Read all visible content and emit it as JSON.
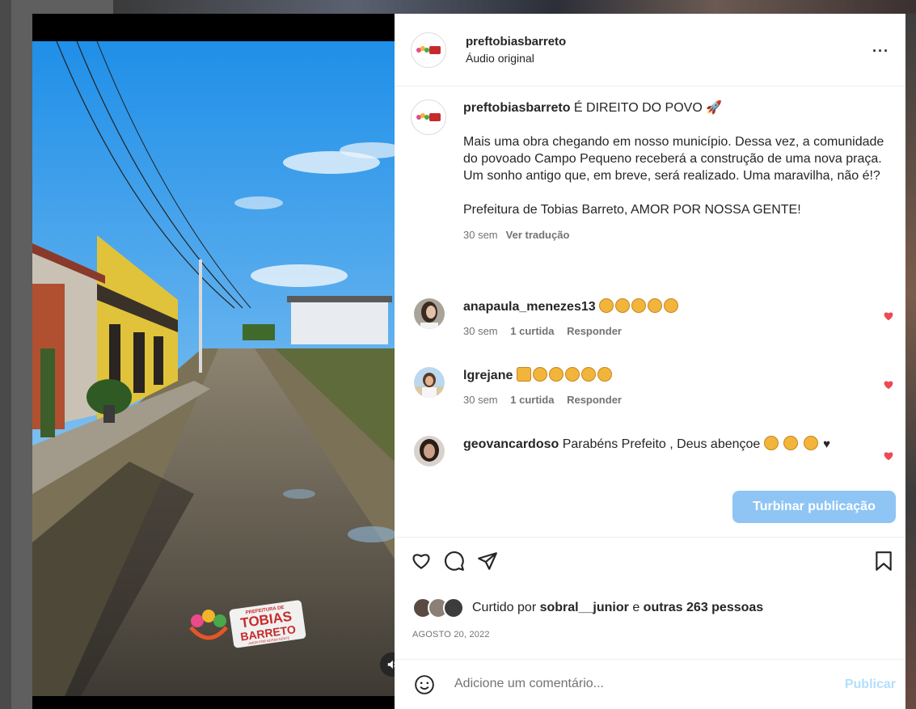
{
  "post": {
    "username": "preftobiasbarreto",
    "audio": "Áudio original",
    "more": "···"
  },
  "caption": {
    "username": "preftobiasbarreto",
    "headline": "É DIREITO DO POVO",
    "rocket": "🚀",
    "paragraph1": "Mais uma obra chegando em nosso município. Dessa vez, a comunidade do povoado Campo Pequeno receberá a construção de uma nova praça. Um sonho antigo que, em breve, será realizado. Uma maravilha, não é!?",
    "paragraph2": "Prefeitura de Tobias Barreto, AMOR POR NOSSA GENTE!",
    "time": "30 sem",
    "translate": "Ver tradução"
  },
  "comments": [
    {
      "username": "anapaula_menezes13",
      "text": "",
      "claps": 5,
      "time": "30 sem",
      "likes": "1 curtida",
      "reply": "Responder"
    },
    {
      "username": "lgrejane",
      "text": "",
      "claps": 5,
      "time": "30 sem",
      "likes": "1 curtida",
      "reply": "Responder"
    },
    {
      "username": "geovancardoso",
      "text": "Parabéns Prefeito , Deus abençoe",
      "claps": 3
    }
  ],
  "boost_label": "Turbinar publicação",
  "likes": {
    "prefix": "Curtido por",
    "user": "sobral__junior",
    "conj": "e",
    "others": "outras 263 pessoas"
  },
  "date": "AGOSTO 20, 2022",
  "add_comment": {
    "placeholder": "Adicione um comentário...",
    "publish": "Publicar"
  },
  "watermark": {
    "line1": "PREFEITURA DE",
    "line2": "TOBIAS",
    "line3": "BARRETO",
    "line4": "AMOR POR NOSSA GENTE"
  },
  "colors": {
    "accent": "#0095f6",
    "boost": "#8ec5f5",
    "like_red": "#ed4956",
    "publish_disabled": "#b2dffc"
  }
}
